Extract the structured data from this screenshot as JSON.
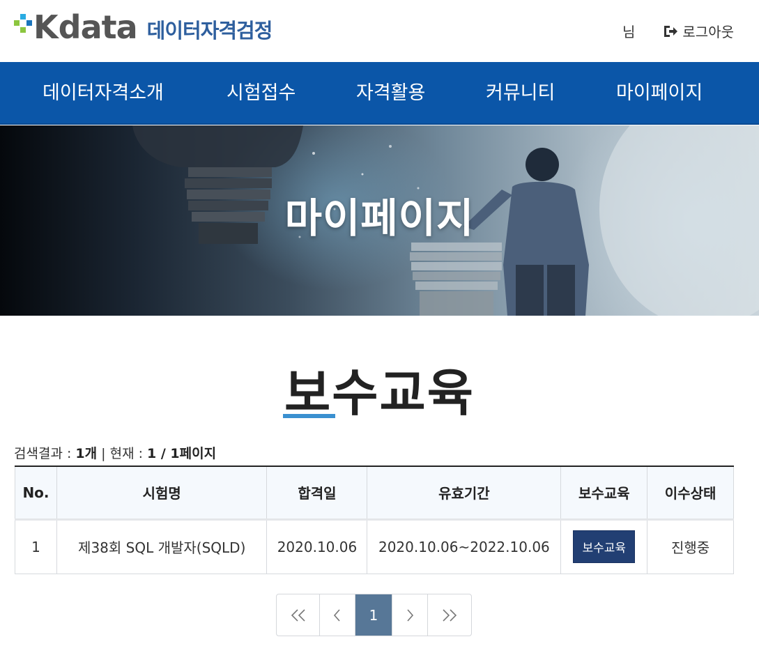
{
  "header": {
    "logo_letter": "K",
    "logo_text": "data",
    "logo_subtitle": "데이터자격검정",
    "user_suffix": "님",
    "logout_label": "로그아웃",
    "colors": {
      "logo_green": "#8cc63f",
      "logo_blue": "#1b75bc",
      "logo_sky": "#29abe2",
      "logo_gray": "#555555",
      "subtitle": "#2e5f9e"
    }
  },
  "nav": {
    "items": [
      {
        "label": "데이터자격소개"
      },
      {
        "label": "시험접수"
      },
      {
        "label": "자격활용"
      },
      {
        "label": "커뮤니티"
      },
      {
        "label": "마이페이지"
      }
    ],
    "background": "#0b56a8"
  },
  "banner": {
    "title": "마이페이지"
  },
  "section": {
    "title": "보수교육",
    "underline_color": "#3a90d0"
  },
  "result": {
    "label": "검색결과 : ",
    "count": "1개",
    "sep": " | 현재 : ",
    "page": "1 / 1페이지"
  },
  "table": {
    "headers": [
      "No.",
      "시험명",
      "합격일",
      "유효기간",
      "보수교육",
      "이수상태"
    ],
    "rows": [
      {
        "no": "1",
        "exam": "제38회 SQL 개발자(SQLD)",
        "pass_date": "2020.10.06",
        "valid_period": "2020.10.06~2022.10.06",
        "edu_button": "보수교육",
        "status": "진행중"
      }
    ]
  },
  "pagination": {
    "first": "«",
    "prev": "‹",
    "current": "1",
    "next": "›",
    "last": "»",
    "active_color": "#577797"
  }
}
